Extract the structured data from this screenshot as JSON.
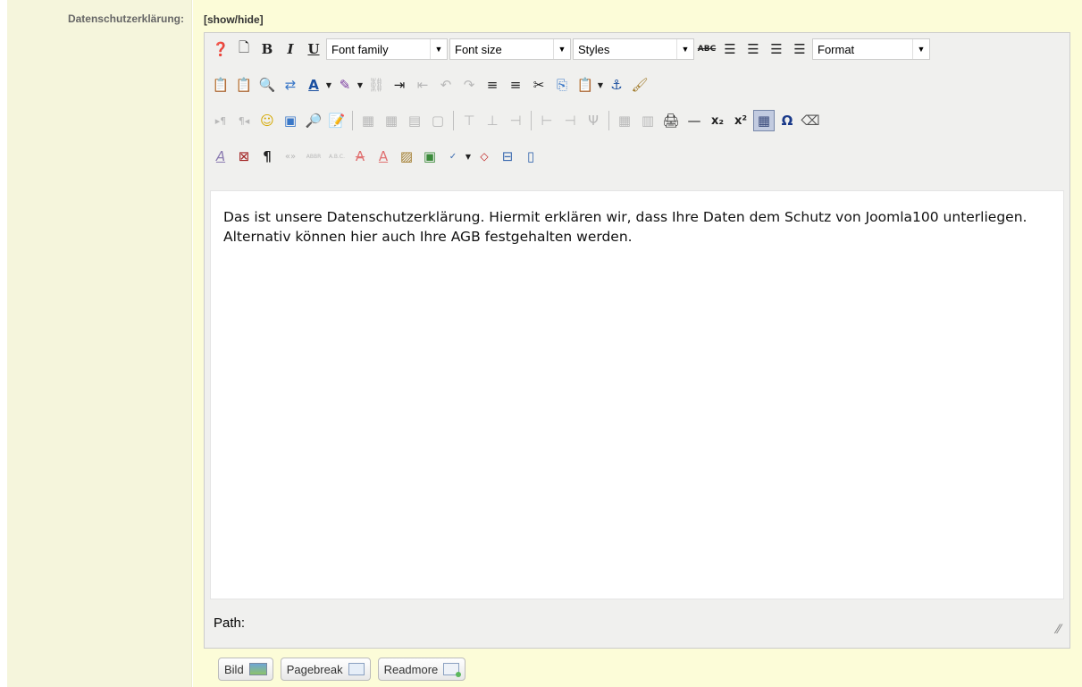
{
  "field": {
    "label": "Datenschutzerklärung:",
    "toggle": "[show/hide]"
  },
  "toolbar": {
    "row1": {
      "font_family": "Font family",
      "font_size": "Font size",
      "styles": "Styles",
      "format": "Format",
      "bold": "B",
      "italic": "I",
      "underline": "U",
      "strike": "ABC"
    },
    "row3": {
      "subscript": "x₂",
      "superscript": "x²",
      "omega": "Ω"
    },
    "row4": {
      "pilcrow": "¶",
      "quote": "«»",
      "abbr": "ABBR",
      "acronym": "A.B.C."
    }
  },
  "editor": {
    "content": "Das ist unsere Datenschutzerklärung. Hiermit erklären wir, dass Ihre Daten dem Schutz von Joomla100 unterliegen. Alternativ können hier auch Ihre AGB festgehalten werden.",
    "path_label": "Path:"
  },
  "buttons": {
    "image": "Bild",
    "pagebreak": "Pagebreak",
    "readmore": "Readmore"
  },
  "colors": {
    "label_bg": "#f5f5dc",
    "field_bg": "#fcfcd8",
    "toolbar_bg": "#f0f0ee"
  }
}
